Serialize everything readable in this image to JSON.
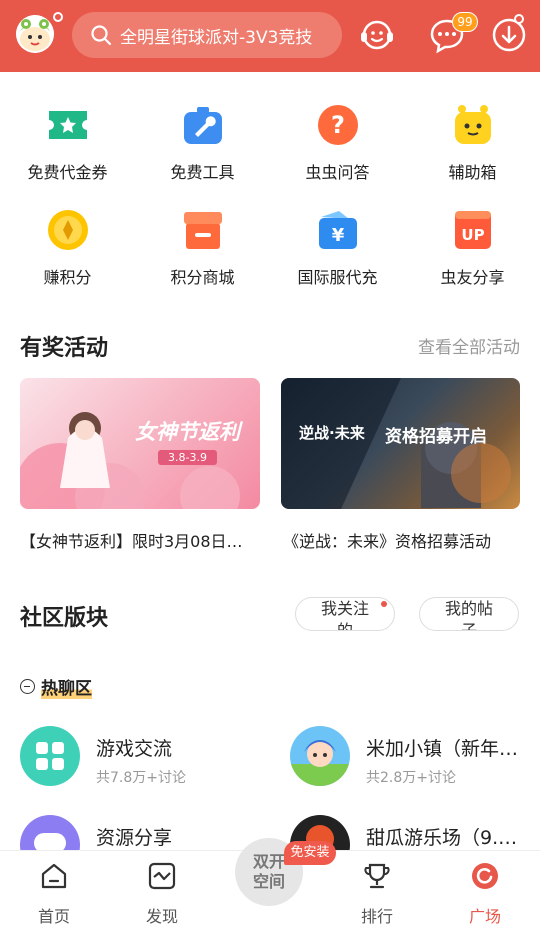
{
  "header": {
    "search_text": "全明星街球派对-3V3竞技",
    "message_badge": "99",
    "colors": {
      "bar": "#e7584a"
    }
  },
  "tools": [
    {
      "label": "免费代金券",
      "icon": "coupon-icon"
    },
    {
      "label": "免费工具",
      "icon": "toolbox-icon"
    },
    {
      "label": "虫虫问答",
      "icon": "question-icon"
    },
    {
      "label": "辅助箱",
      "icon": "robot-icon"
    },
    {
      "label": "赚积分",
      "icon": "coin-icon"
    },
    {
      "label": "积分商城",
      "icon": "shop-icon"
    },
    {
      "label": "国际服代充",
      "icon": "wallet-icon"
    },
    {
      "label": "虫友分享",
      "icon": "up-icon"
    }
  ],
  "activities": {
    "title": "有奖活动",
    "view_all": "查看全部活动",
    "items": [
      {
        "caption": "【女神节返利】限时3月08日…",
        "banner_title": "女神节返利",
        "banner_date": "3.8-3.9"
      },
      {
        "caption": "《逆战：未来》资格招募活动",
        "banner_logo": "逆战·未来",
        "banner_title": "资格招募开启"
      }
    ]
  },
  "community": {
    "title": "社区版块",
    "follow_btn": "我关注的",
    "posts_btn": "我的帖子",
    "hot_label": "热聊区",
    "boards": [
      {
        "name": "游戏交流",
        "sub": "共7.8万+讨论"
      },
      {
        "name": "米加小镇（新年…",
        "sub": "共2.8万+讨论"
      },
      {
        "name": "资源分享",
        "sub": ""
      },
      {
        "name": "甜瓜游乐场（9.…",
        "sub": ""
      }
    ]
  },
  "tabbar": {
    "home": "首页",
    "discover": "发现",
    "center_line1": "双开",
    "center_line2": "空间",
    "center_badge": "免安装",
    "rank": "排行",
    "plaza": "广场"
  }
}
